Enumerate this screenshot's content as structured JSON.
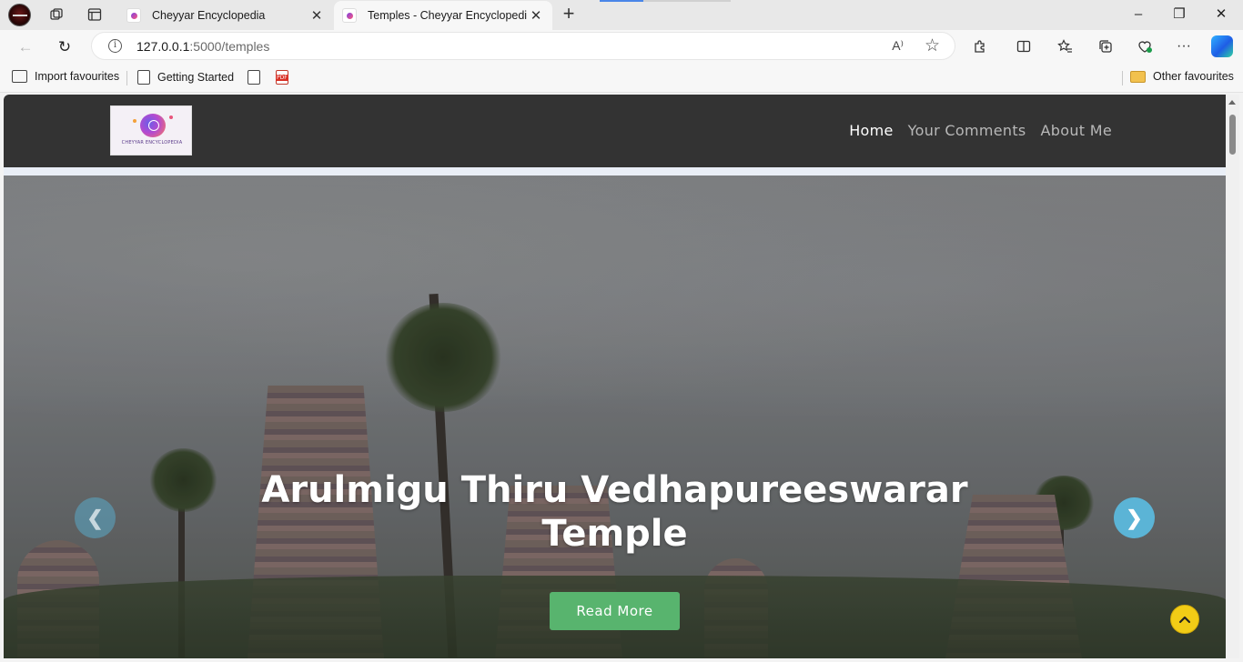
{
  "browser": {
    "tabs": [
      {
        "title": "Cheyyar Encyclopedia",
        "active": false
      },
      {
        "title": "Temples - Cheyyar Encyclopedia",
        "active": true
      }
    ],
    "address": {
      "host": "127.0.0.1",
      "path": ":5000/temples"
    },
    "favourites": [
      {
        "label": "Import favourites"
      },
      {
        "label": "Getting Started"
      }
    ],
    "other_favourites": "Other favourites",
    "icons": {
      "new_tab": "+",
      "minimize": "–",
      "restore": "❐",
      "close": "✕",
      "tab_close": "✕",
      "back": "←",
      "refresh": "↻",
      "read_aloud": "A⁾",
      "favorite": "☆",
      "more": "···"
    }
  },
  "site": {
    "logo_text": "CHEYYAR ENCYCLOPEDIA",
    "nav": [
      {
        "label": "Home",
        "current": true
      },
      {
        "label": "Your Comments",
        "current": false
      },
      {
        "label": "About Me",
        "current": false
      }
    ],
    "hero": {
      "title": "Arulmigu Thiru Vedhapureeswarar Temple",
      "button": "Read More",
      "prev_icon": "❮",
      "next_icon": "❯"
    },
    "colors": {
      "header_bg": "#333333",
      "button_green": "#58b46e",
      "carousel_blue": "#5bb4d6",
      "back_to_top_yellow": "#f2cc16"
    }
  }
}
